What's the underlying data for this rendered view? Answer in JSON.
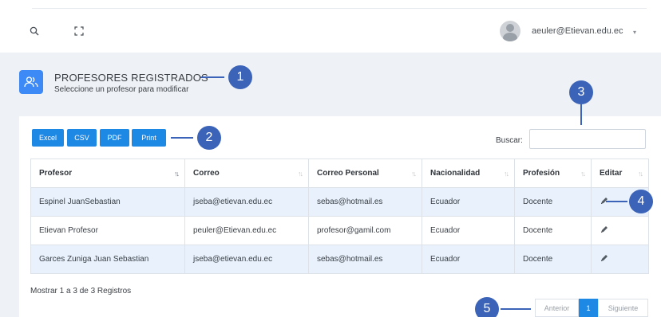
{
  "topbar": {
    "user_email": "aeuler@Etievan.edu.ec",
    "user_caret": "▾"
  },
  "header": {
    "title": "PROFESORES REGISTRADOS",
    "subtitle": "Seleccione un profesor para modificar"
  },
  "toolbar": {
    "buttons": [
      "Excel",
      "CSV",
      "PDF",
      "Print"
    ],
    "search_label": "Buscar:",
    "search_value": ""
  },
  "table": {
    "columns": [
      "Profesor",
      "Correo",
      "Correo Personal",
      "Nacionalidad",
      "Profesión",
      "Editar"
    ],
    "rows": [
      [
        "Espinel JuanSebastian",
        "jseba@etievan.edu.ec",
        "sebas@hotmail.es",
        "Ecuador",
        "Docente"
      ],
      [
        "Etievan Profesor",
        "peuler@Etievan.edu.ec",
        "profesor@gamil.com",
        "Ecuador",
        "Docente"
      ],
      [
        "Garces Zuniga Juan Sebastian",
        "jseba@etievan.edu.ec",
        "sebas@hotmail.es",
        "Ecuador",
        "Docente"
      ]
    ]
  },
  "footer": {
    "records_info": "Mostrar 1 a 3 de 3 Registros"
  },
  "pagination": {
    "prev": "Anterior",
    "current": "1",
    "next": "Siguiente"
  },
  "callouts": [
    "1",
    "2",
    "3",
    "4",
    "5"
  ],
  "colors": {
    "accent": "#1e88e5",
    "callout": "#3b63b8",
    "row_highlight": "#e8f1fc",
    "page_bg": "#eef2f6"
  },
  "icons": [
    "search-icon",
    "fullscreen-icon",
    "users-icon",
    "sort-icon",
    "pencil-icon"
  ]
}
